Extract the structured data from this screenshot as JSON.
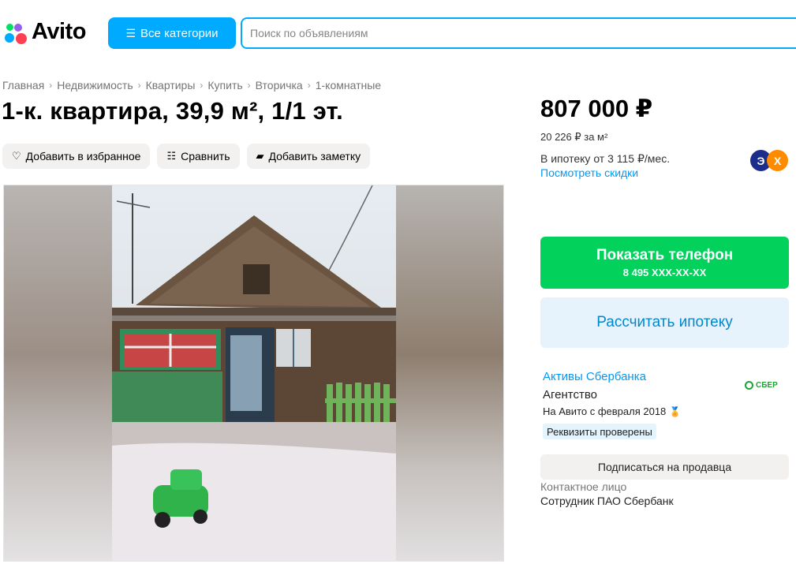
{
  "header": {
    "logo_text": "Avito",
    "categories_label": "Все категории",
    "categories_icon": "list-search-icon",
    "search_placeholder": "Поиск по объявлениям"
  },
  "breadcrumbs": [
    "Главная",
    "Недвижимость",
    "Квартиры",
    "Купить",
    "Вторичка",
    "1-комнатные"
  ],
  "listing": {
    "title": "1-к. квартира, 39,9 м², 1/1 эт.",
    "actions": {
      "favorite": "Добавить в избранное",
      "compare": "Сравнить",
      "note": "Добавить заметку"
    }
  },
  "pricing": {
    "price": "807 000 ₽",
    "price_per_m2": "20 226 ₽ за м²",
    "mortgage_text": "В ипотеку от 3 115 ₽/мес.",
    "discounts_link": "Посмотреть скидки",
    "badge_left": "Э",
    "badge_right": "Х"
  },
  "buttons": {
    "show_phone": "Показать телефон",
    "phone_masked": "8 495 XXX-XX-XX",
    "calc_mortgage": "Рассчитать ипотеку",
    "subscribe": "Подписаться на продавца"
  },
  "seller": {
    "name": "Активы Сбербанка",
    "logo_text": "СБЕР",
    "type": "Агентство",
    "since": "На Авито с февраля 2018",
    "verified": "Реквизиты проверены",
    "contact_label": "Контактное лицо",
    "contact_value": "Сотрудник ПАО Сбербанк"
  },
  "colors": {
    "accent": "#00aaff",
    "phone_button": "#02d15c",
    "link": "#0099f7",
    "mortgage_button_bg": "#e6f3fc"
  }
}
